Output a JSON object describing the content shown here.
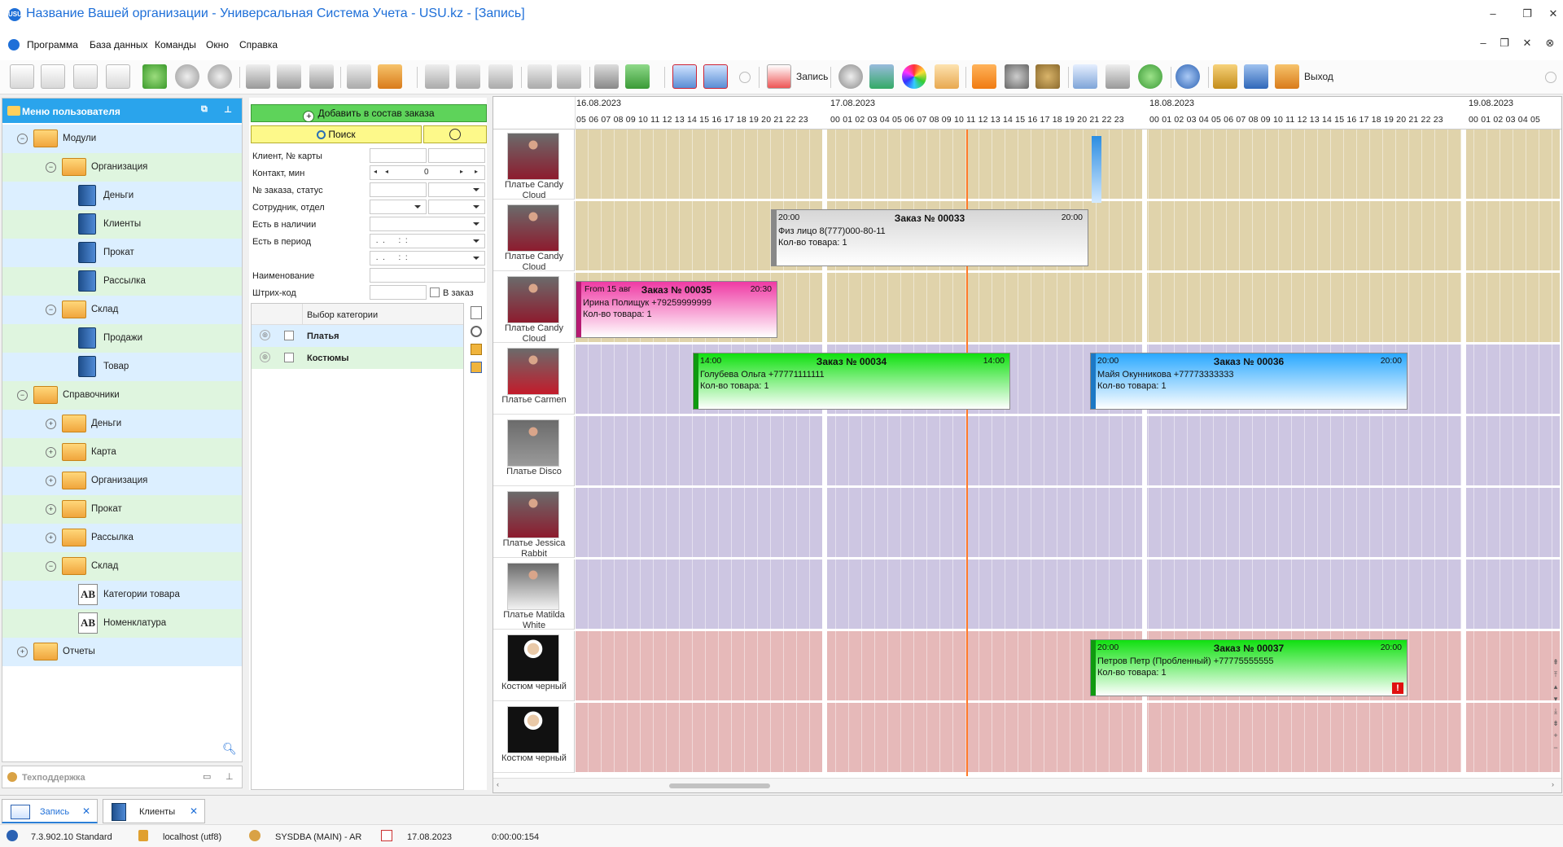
{
  "window": {
    "title": "Название Вашей организации - Универсальная Система Учета - USU.kz - [Запись]",
    "logo_text": "USU"
  },
  "menu": [
    "Программа",
    "База данных",
    "Команды",
    "Окно",
    "Справка"
  ],
  "toolbar": {
    "record_label": "Запись",
    "exit_label": "Выход"
  },
  "left_panel": {
    "title": "Меню пользователя",
    "tree": [
      {
        "label": "Модули",
        "level": 0,
        "type": "folder",
        "bg": "blue",
        "exp": "⊖"
      },
      {
        "label": "Организация",
        "level": 1,
        "type": "folder",
        "bg": "green",
        "exp": "⊖"
      },
      {
        "label": "Деньги",
        "level": 2,
        "type": "book",
        "bg": "blue",
        "exp": ""
      },
      {
        "label": "Клиенты",
        "level": 2,
        "type": "book",
        "bg": "green",
        "exp": ""
      },
      {
        "label": "Прокат",
        "level": 2,
        "type": "book",
        "bg": "blue",
        "exp": ""
      },
      {
        "label": "Рассылка",
        "level": 2,
        "type": "book",
        "bg": "green",
        "exp": ""
      },
      {
        "label": "Склад",
        "level": 1,
        "type": "folder",
        "bg": "blue",
        "exp": "⊖"
      },
      {
        "label": "Продажи",
        "level": 2,
        "type": "book",
        "bg": "green",
        "exp": ""
      },
      {
        "label": "Товар",
        "level": 2,
        "type": "book",
        "bg": "blue",
        "exp": ""
      },
      {
        "label": "Справочники",
        "level": 0,
        "type": "folder",
        "bg": "green",
        "exp": "⊖"
      },
      {
        "label": "Деньги",
        "level": 1,
        "type": "folder",
        "bg": "blue",
        "exp": "⊕"
      },
      {
        "label": "Карта",
        "level": 1,
        "type": "folder",
        "bg": "green",
        "exp": "⊕"
      },
      {
        "label": "Организация",
        "level": 1,
        "type": "folder",
        "bg": "blue",
        "exp": "⊕"
      },
      {
        "label": "Прокат",
        "level": 1,
        "type": "folder",
        "bg": "green",
        "exp": "⊕"
      },
      {
        "label": "Рассылка",
        "level": 1,
        "type": "folder",
        "bg": "blue",
        "exp": "⊕"
      },
      {
        "label": "Склад",
        "level": 1,
        "type": "folder",
        "bg": "green",
        "exp": "⊖"
      },
      {
        "label": "Категории товара",
        "level": 2,
        "type": "ab",
        "bg": "blue",
        "exp": ""
      },
      {
        "label": "Номенклатура",
        "level": 2,
        "type": "ab",
        "bg": "green",
        "exp": ""
      },
      {
        "label": "Отчеты",
        "level": 0,
        "type": "folder",
        "bg": "blue",
        "exp": "⊕"
      }
    ],
    "ab_text": "AB",
    "support_label": "Техподдержка"
  },
  "filter_panel": {
    "add_button": "Добавить в состав заказа",
    "search_button": "Поиск",
    "fields": {
      "client": "Клиент, № карты",
      "contact": "Контакт, мин",
      "order": "№ заказа, статус",
      "employee": "Сотрудник, отдел",
      "in_stock": "Есть в наличии",
      "in_period": "Есть в период",
      "name": "Наименование",
      "barcode": "Штрих-код"
    },
    "contact_value": "0",
    "period_placeholder": " .  .      :  :",
    "in_order_label": "В заказ",
    "category_header": "Выбор категории",
    "categories": [
      "Платья",
      "Костюмы"
    ]
  },
  "scheduler": {
    "days": [
      "16.08.2023",
      "17.08.2023",
      "18.08.2023",
      "19.08.2023"
    ],
    "hours_day1": "05 06 07 08 09 10 11 12 13 14 15 16 17 18 19 20 21 22 23",
    "hours_full": "00 01 02 03 04 05 06 07 08 09 10 11 12 13 14 15 16 17 18 19 20 21 22 23",
    "hours_day4": "00 01 02 03 04 05",
    "resources": [
      {
        "name": "Платье Candy Cloud",
        "band": "#e0d3ab"
      },
      {
        "name": "Платье Candy Cloud",
        "band": "#e0d3ab"
      },
      {
        "name": "Платье Candy Cloud",
        "band": "#e0d3ab"
      },
      {
        "name": "Платье Carmen",
        "band": "#cdc6e2"
      },
      {
        "name": "Платье Disco",
        "band": "#cdc6e2"
      },
      {
        "name": "Платье Jessica Rabbit",
        "band": "#cdc6e2"
      },
      {
        "name": "Платье Matilda White",
        "band": "#cdc6e2"
      },
      {
        "name": "Костюм черный",
        "band": "#e6b9b9"
      },
      {
        "name": "Костюм черный",
        "band": "#e6b9b9"
      }
    ],
    "appointments": [
      {
        "title": "Заказ № 00033",
        "start": "20:00",
        "end": "20:00",
        "line1": "Физ лицо 8(777)000-80-11",
        "line2": "Кол-во товара: 1",
        "color": "gray"
      },
      {
        "title": "Заказ № 00035",
        "start": "From 15 авг",
        "end": "20:30",
        "line1": "Ирина Полищук +79259999999",
        "line2": "Кол-во товара: 1",
        "color": "pink"
      },
      {
        "title": "Заказ № 00034",
        "start": "14:00",
        "end": "14:00",
        "line1": "Голубева Ольга +77771111111",
        "line2": "Кол-во товара: 1",
        "color": "green"
      },
      {
        "title": "Заказ № 00036",
        "start": "20:00",
        "end": "20:00",
        "line1": "Майя Окунникова +77773333333",
        "line2": "Кол-во товара: 1",
        "color": "blue"
      },
      {
        "title": "Заказ № 00037",
        "start": "20:00",
        "end": "20:00",
        "line1": "Петров Петр (Пробленный) +77775555555",
        "line2": "Кол-во товара: 1",
        "color": "green"
      }
    ],
    "alert_mark": "!"
  },
  "tabs": [
    {
      "label": "Запись"
    },
    {
      "label": "Клиенты"
    }
  ],
  "status": {
    "version": "7.3.902.10 Standard",
    "db": "localhost (utf8)",
    "user": "SYSDBA (MAIN) - AR",
    "date": "17.08.2023",
    "timer": "0:00:00:154"
  }
}
